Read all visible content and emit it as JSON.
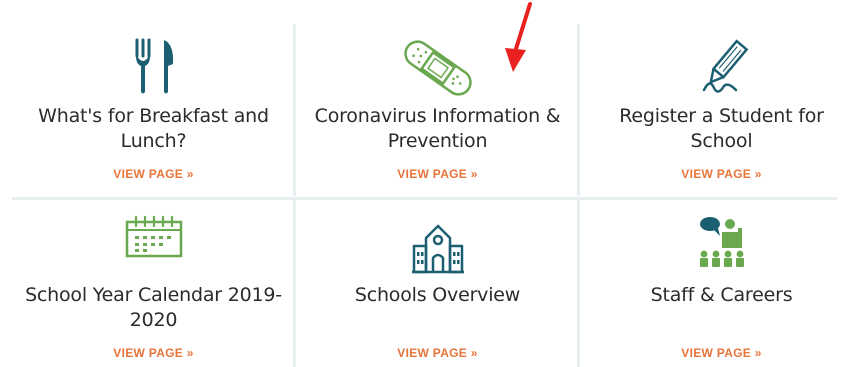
{
  "tiles": [
    {
      "title": "What's for Breakfast and Lunch?",
      "link": "VIEW PAGE »",
      "icon": "fork-knife-icon"
    },
    {
      "title": "Coronavirus Information & Prevention",
      "link": "VIEW PAGE »",
      "icon": "bandage-icon"
    },
    {
      "title": "Register a Student for School",
      "link": "VIEW PAGE »",
      "icon": "pencil-icon"
    },
    {
      "title": "School Year Calendar 2019-2020",
      "link": "VIEW PAGE »",
      "icon": "calendar-icon"
    },
    {
      "title": "Schools Overview",
      "link": "VIEW PAGE »",
      "icon": "schoolhouse-icon"
    },
    {
      "title": "Staff & Careers",
      "link": "VIEW PAGE »",
      "icon": "teacher-classroom-icon"
    }
  ],
  "colors": {
    "teal": "#1d5f72",
    "green": "#6aa84f",
    "link": "#e7743a",
    "text": "#2b2b2b",
    "divider": "#e9eef1",
    "annotation_arrow": "#e8201e"
  }
}
